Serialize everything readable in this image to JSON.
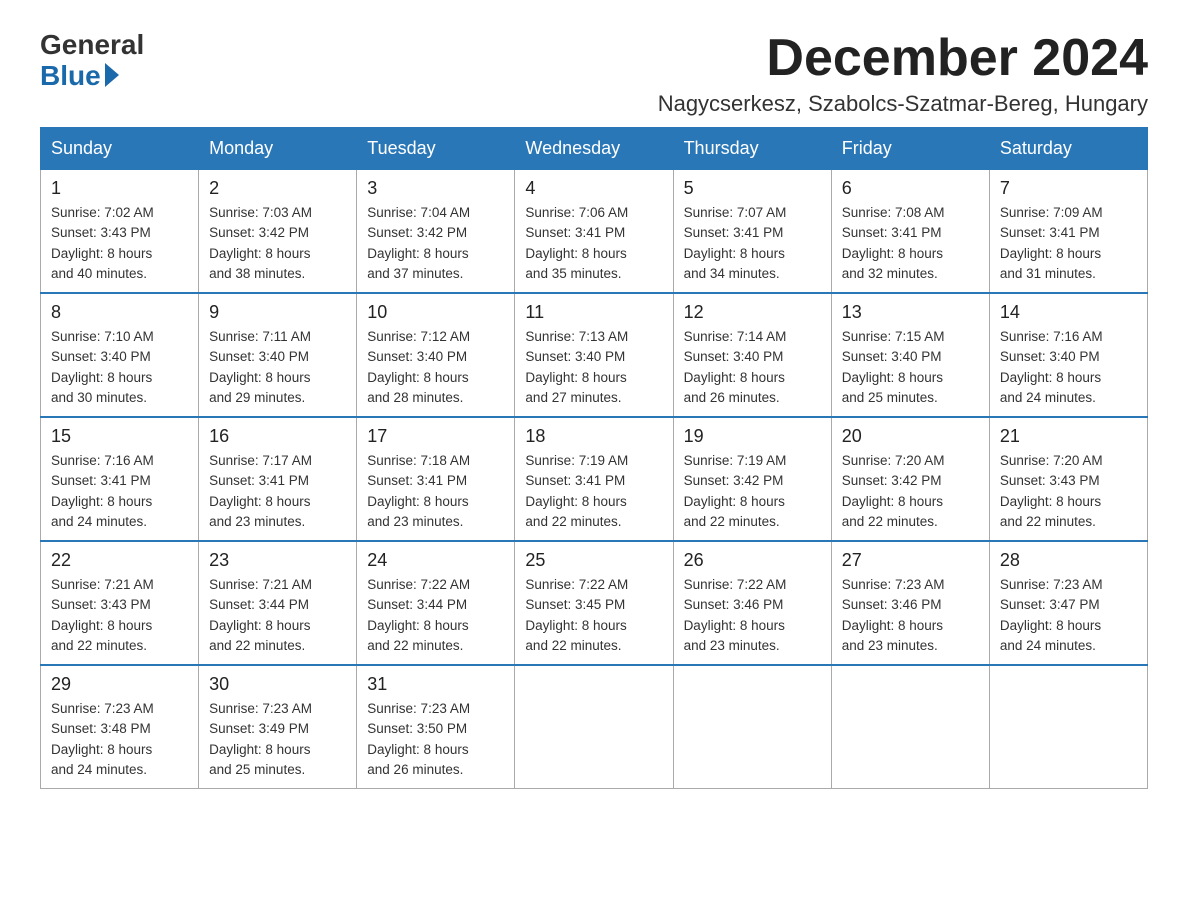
{
  "header": {
    "logo_general": "General",
    "logo_blue": "Blue",
    "month_title": "December 2024",
    "location": "Nagycserkesz, Szabolcs-Szatmar-Bereg, Hungary"
  },
  "days_of_week": [
    "Sunday",
    "Monday",
    "Tuesday",
    "Wednesday",
    "Thursday",
    "Friday",
    "Saturday"
  ],
  "weeks": [
    [
      {
        "day": "1",
        "sunrise": "7:02 AM",
        "sunset": "3:43 PM",
        "daylight": "8 hours and 40 minutes."
      },
      {
        "day": "2",
        "sunrise": "7:03 AM",
        "sunset": "3:42 PM",
        "daylight": "8 hours and 38 minutes."
      },
      {
        "day": "3",
        "sunrise": "7:04 AM",
        "sunset": "3:42 PM",
        "daylight": "8 hours and 37 minutes."
      },
      {
        "day": "4",
        "sunrise": "7:06 AM",
        "sunset": "3:41 PM",
        "daylight": "8 hours and 35 minutes."
      },
      {
        "day": "5",
        "sunrise": "7:07 AM",
        "sunset": "3:41 PM",
        "daylight": "8 hours and 34 minutes."
      },
      {
        "day": "6",
        "sunrise": "7:08 AM",
        "sunset": "3:41 PM",
        "daylight": "8 hours and 32 minutes."
      },
      {
        "day": "7",
        "sunrise": "7:09 AM",
        "sunset": "3:41 PM",
        "daylight": "8 hours and 31 minutes."
      }
    ],
    [
      {
        "day": "8",
        "sunrise": "7:10 AM",
        "sunset": "3:40 PM",
        "daylight": "8 hours and 30 minutes."
      },
      {
        "day": "9",
        "sunrise": "7:11 AM",
        "sunset": "3:40 PM",
        "daylight": "8 hours and 29 minutes."
      },
      {
        "day": "10",
        "sunrise": "7:12 AM",
        "sunset": "3:40 PM",
        "daylight": "8 hours and 28 minutes."
      },
      {
        "day": "11",
        "sunrise": "7:13 AM",
        "sunset": "3:40 PM",
        "daylight": "8 hours and 27 minutes."
      },
      {
        "day": "12",
        "sunrise": "7:14 AM",
        "sunset": "3:40 PM",
        "daylight": "8 hours and 26 minutes."
      },
      {
        "day": "13",
        "sunrise": "7:15 AM",
        "sunset": "3:40 PM",
        "daylight": "8 hours and 25 minutes."
      },
      {
        "day": "14",
        "sunrise": "7:16 AM",
        "sunset": "3:40 PM",
        "daylight": "8 hours and 24 minutes."
      }
    ],
    [
      {
        "day": "15",
        "sunrise": "7:16 AM",
        "sunset": "3:41 PM",
        "daylight": "8 hours and 24 minutes."
      },
      {
        "day": "16",
        "sunrise": "7:17 AM",
        "sunset": "3:41 PM",
        "daylight": "8 hours and 23 minutes."
      },
      {
        "day": "17",
        "sunrise": "7:18 AM",
        "sunset": "3:41 PM",
        "daylight": "8 hours and 23 minutes."
      },
      {
        "day": "18",
        "sunrise": "7:19 AM",
        "sunset": "3:41 PM",
        "daylight": "8 hours and 22 minutes."
      },
      {
        "day": "19",
        "sunrise": "7:19 AM",
        "sunset": "3:42 PM",
        "daylight": "8 hours and 22 minutes."
      },
      {
        "day": "20",
        "sunrise": "7:20 AM",
        "sunset": "3:42 PM",
        "daylight": "8 hours and 22 minutes."
      },
      {
        "day": "21",
        "sunrise": "7:20 AM",
        "sunset": "3:43 PM",
        "daylight": "8 hours and 22 minutes."
      }
    ],
    [
      {
        "day": "22",
        "sunrise": "7:21 AM",
        "sunset": "3:43 PM",
        "daylight": "8 hours and 22 minutes."
      },
      {
        "day": "23",
        "sunrise": "7:21 AM",
        "sunset": "3:44 PM",
        "daylight": "8 hours and 22 minutes."
      },
      {
        "day": "24",
        "sunrise": "7:22 AM",
        "sunset": "3:44 PM",
        "daylight": "8 hours and 22 minutes."
      },
      {
        "day": "25",
        "sunrise": "7:22 AM",
        "sunset": "3:45 PM",
        "daylight": "8 hours and 22 minutes."
      },
      {
        "day": "26",
        "sunrise": "7:22 AM",
        "sunset": "3:46 PM",
        "daylight": "8 hours and 23 minutes."
      },
      {
        "day": "27",
        "sunrise": "7:23 AM",
        "sunset": "3:46 PM",
        "daylight": "8 hours and 23 minutes."
      },
      {
        "day": "28",
        "sunrise": "7:23 AM",
        "sunset": "3:47 PM",
        "daylight": "8 hours and 24 minutes."
      }
    ],
    [
      {
        "day": "29",
        "sunrise": "7:23 AM",
        "sunset": "3:48 PM",
        "daylight": "8 hours and 24 minutes."
      },
      {
        "day": "30",
        "sunrise": "7:23 AM",
        "sunset": "3:49 PM",
        "daylight": "8 hours and 25 minutes."
      },
      {
        "day": "31",
        "sunrise": "7:23 AM",
        "sunset": "3:50 PM",
        "daylight": "8 hours and 26 minutes."
      },
      null,
      null,
      null,
      null
    ]
  ],
  "labels": {
    "sunrise_prefix": "Sunrise: ",
    "sunset_prefix": "Sunset: ",
    "daylight_prefix": "Daylight: "
  }
}
